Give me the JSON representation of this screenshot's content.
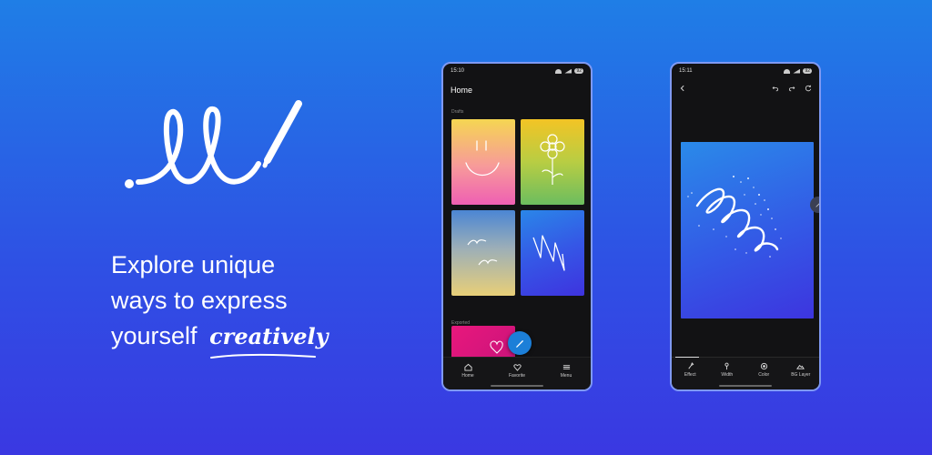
{
  "tagline": {
    "line1": "Explore unique",
    "line2": "ways to express",
    "line3_prefix": "yourself",
    "line3_highlight": "creatively"
  },
  "colors": {
    "background_top": "#1f7ee6",
    "background_bottom": "#3a38e2",
    "fab": "#1c7fd8",
    "phone_border": "#7f99f2"
  },
  "phone_home": {
    "status_time": "15:10",
    "battery": "92",
    "title": "Home",
    "drafts_label": "Drafts",
    "exported_label": "Exported",
    "fab_icon": "pen-icon",
    "nav": [
      {
        "label": "Home",
        "icon": "home-icon"
      },
      {
        "label": "Favorite",
        "icon": "heart-icon"
      },
      {
        "label": "Menu",
        "icon": "menu-icon"
      }
    ]
  },
  "phone_editor": {
    "status_time": "15:11",
    "battery": "92",
    "tools": [
      {
        "label": "Effect",
        "icon": "brush-icon"
      },
      {
        "label": "Width",
        "icon": "pin-icon"
      },
      {
        "label": "Color",
        "icon": "color-icon"
      },
      {
        "label": "BG Layer",
        "icon": "layer-icon"
      }
    ]
  }
}
